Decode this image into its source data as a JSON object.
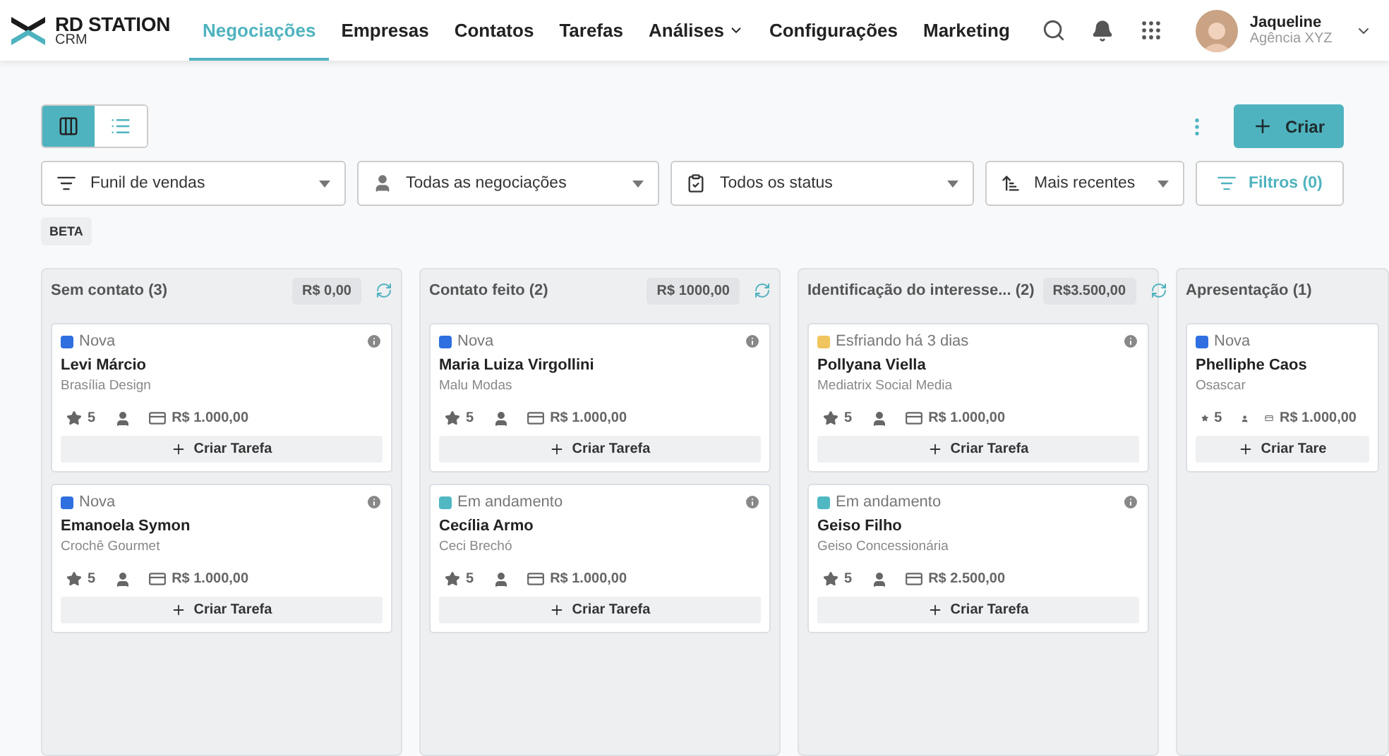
{
  "brand": {
    "name": "RD STATION",
    "sub": "CRM"
  },
  "nav": [
    {
      "label": "Negociações",
      "selected": true,
      "dropdown": false
    },
    {
      "label": "Empresas",
      "selected": false,
      "dropdown": false
    },
    {
      "label": "Contatos",
      "selected": false,
      "dropdown": false
    },
    {
      "label": "Tarefas",
      "selected": false,
      "dropdown": false
    },
    {
      "label": "Análises",
      "selected": false,
      "dropdown": true
    },
    {
      "label": "Configurações",
      "selected": false,
      "dropdown": false
    },
    {
      "label": "Marketing",
      "selected": false,
      "dropdown": false
    }
  ],
  "user": {
    "name": "Jaqueline",
    "org": "Agência XYZ"
  },
  "views": [
    {
      "kind": "board",
      "selected": true
    },
    {
      "kind": "list",
      "selected": false
    }
  ],
  "create_button": "Criar",
  "filters": [
    {
      "kind": "funnel",
      "label": "Funil de vendas"
    },
    {
      "kind": "person",
      "label": "Todas as negociações"
    },
    {
      "kind": "status",
      "label": "Todos os status"
    },
    {
      "kind": "sort",
      "label": "Mais recentes"
    }
  ],
  "filters_button": "Filtros (0)",
  "beta_badge": "BETA",
  "columns": [
    {
      "title": "Sem contato",
      "count": "(3)",
      "total": "R$ 0,00",
      "cards": [
        {
          "status": "Nova",
          "color": "#2f6fe0",
          "name": "Levi Márcio",
          "company": "Brasília Design",
          "rating": "5",
          "value": "R$ 1.000,00",
          "task_button": "Criar Tarefa"
        },
        {
          "status": "Nova",
          "color": "#2f6fe0",
          "name": "Emanoela Symon",
          "company": "Crochê Gourmet",
          "rating": "5",
          "value": "R$ 1.000,00",
          "task_button": "Criar Tarefa"
        }
      ]
    },
    {
      "title": "Contato feito",
      "count": "(2)",
      "total": "R$ 1000,00",
      "cards": [
        {
          "status": "Nova",
          "color": "#2f6fe0",
          "name": "Maria Luiza Virgollini",
          "company": "Malu Modas",
          "rating": "5",
          "value": "R$ 1.000,00",
          "task_button": "Criar Tarefa"
        },
        {
          "status": "Em andamento",
          "color": "#4fb8c3",
          "name": "Cecília Armo",
          "company": "Ceci Brechó",
          "rating": "5",
          "value": "R$ 1.000,00",
          "task_button": "Criar Tarefa"
        }
      ]
    },
    {
      "title": "Identificação do interesse...",
      "count": "(2)",
      "total": "R$3.500,00",
      "cards": [
        {
          "status": "Esfriando há 3 dias",
          "color": "#f0c55e",
          "name": "Pollyana Viella",
          "company": "Mediatrix Social Media",
          "rating": "5",
          "value": "R$ 1.000,00",
          "task_button": "Criar Tarefa"
        },
        {
          "status": "Em andamento",
          "color": "#4fb8c3",
          "name": "Geiso Filho",
          "company": "Geiso Concessionária",
          "rating": "5",
          "value": "R$ 2.500,00",
          "task_button": "Criar Tarefa"
        }
      ]
    },
    {
      "title": "Apresentação",
      "count": "(1)",
      "cards": [
        {
          "status": "Nova",
          "color": "#2f6fe0",
          "name": "Phelliphe Caos",
          "company": "Osascar",
          "rating": "5",
          "value": "R$ 1.000,00",
          "task_button": "Criar Tare"
        }
      ]
    }
  ]
}
